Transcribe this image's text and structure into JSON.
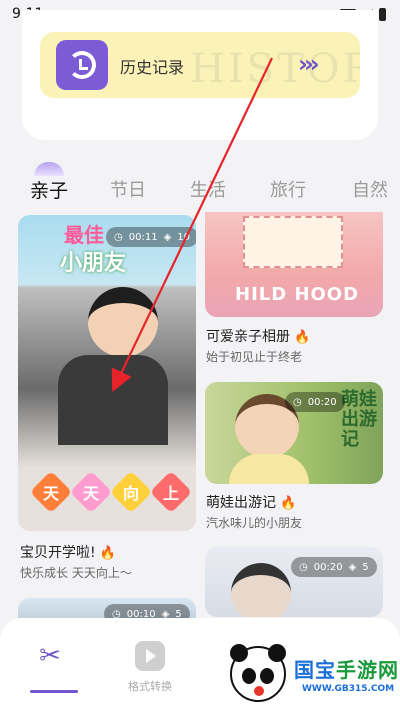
{
  "status_bar": {
    "time": "9:11"
  },
  "history": {
    "label": "历史记录",
    "watermark": "HISTORY",
    "arrow": "›››"
  },
  "tabs": [
    {
      "label": "亲子",
      "active": true
    },
    {
      "label": "节日",
      "active": false
    },
    {
      "label": "生活",
      "active": false
    },
    {
      "label": "旅行",
      "active": false
    },
    {
      "label": "自然",
      "active": false
    }
  ],
  "cards": [
    {
      "title": "宝贝开学啦!",
      "subtitle": "快乐成长 天天向上～",
      "duration": "00:11",
      "layers": "10",
      "art_title_line1": "最佳",
      "art_title_line2": "小朋友",
      "banner_chars": [
        "天",
        "天",
        "向",
        "上"
      ]
    },
    {
      "title": "可爱亲子相册",
      "subtitle": "始于初见止于终老",
      "art_text": "HILD HOOD"
    },
    {
      "title": "萌娃出游记",
      "subtitle": "汽水味儿的小朋友",
      "duration": "00:20",
      "art_text": "萌娃出游记"
    },
    {
      "duration": "00:20",
      "layers": "5"
    },
    {
      "duration": "00:10",
      "layers": "5"
    }
  ],
  "flame_icon": "fire-icon",
  "bottom_nav": [
    {
      "label": "",
      "icon": "scissors-icon",
      "active": true
    },
    {
      "label": "格式转换",
      "icon": "format-convert-icon",
      "active": false
    }
  ],
  "watermark": {
    "name_part1": "国宝",
    "name_part2": "手游网",
    "url": "WWW.GB315.COM"
  },
  "colors": {
    "accent": "#6f56cc",
    "banner_bg": "#fbf2b8",
    "flame": "#ff7a2a"
  }
}
